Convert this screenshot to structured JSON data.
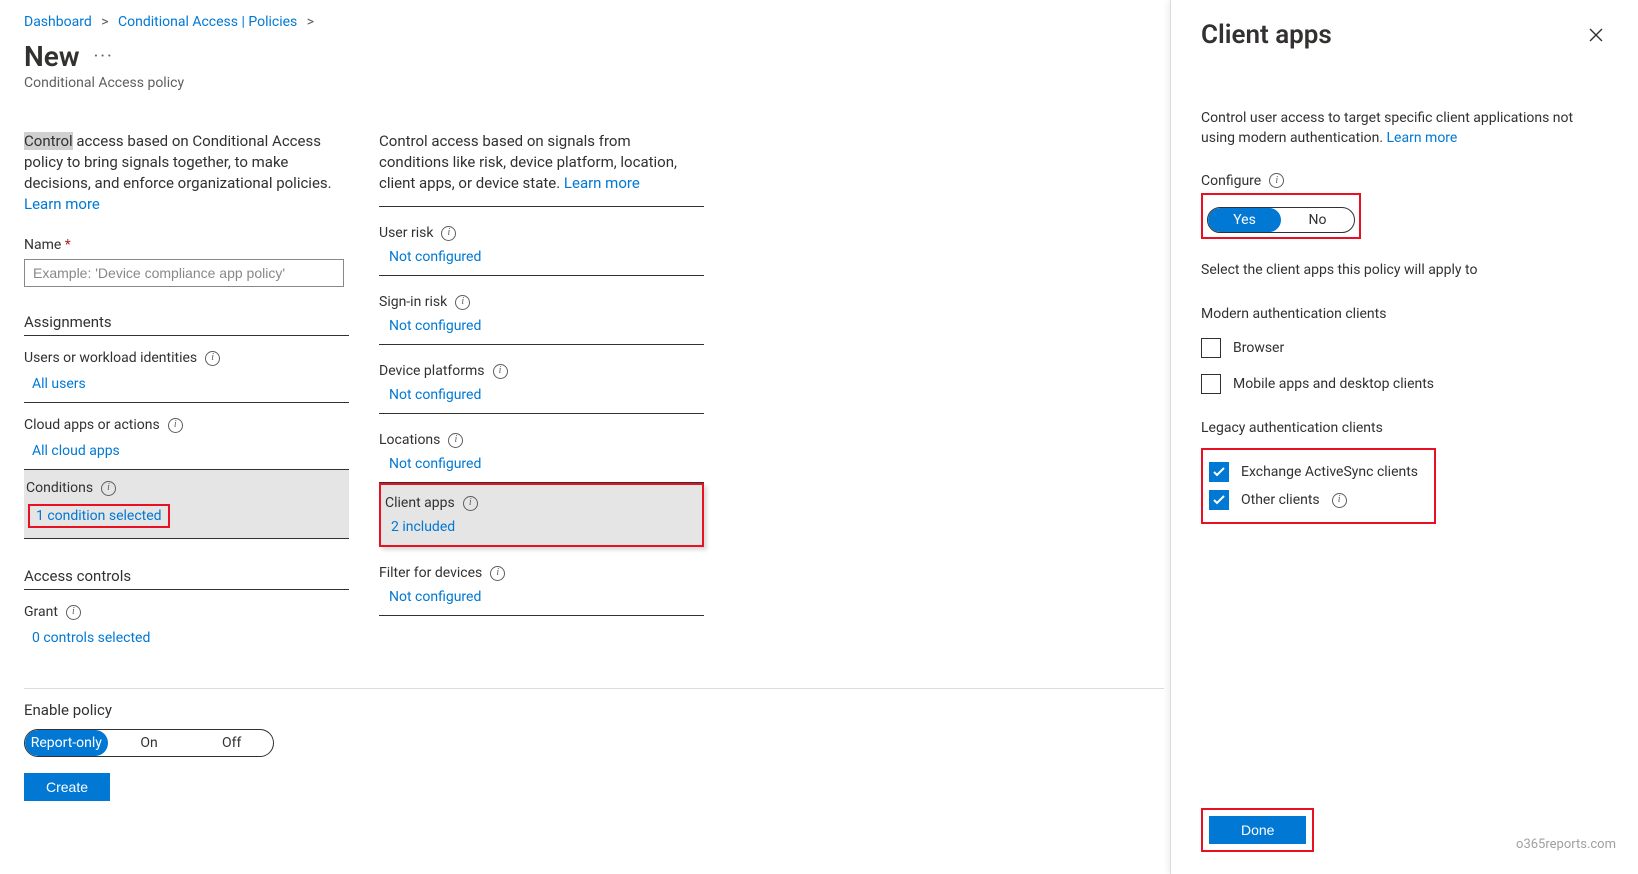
{
  "breadcrumb": {
    "items": [
      "Dashboard",
      "Conditional Access | Policies"
    ]
  },
  "header": {
    "title": "New",
    "subtitle": "Conditional Access policy"
  },
  "left": {
    "intro_hl": "Control",
    "intro_rest": " access based on Conditional Access policy to bring signals together, to make decisions, and enforce organizational policies. ",
    "learn_more": "Learn more",
    "name_label": "Name",
    "name_placeholder": "Example: 'Device compliance app policy'",
    "assignments_header": "Assignments",
    "users_label": "Users or workload identities",
    "users_value": "All users",
    "cloud_label": "Cloud apps or actions",
    "cloud_value": "All cloud apps",
    "conditions_label": "Conditions",
    "conditions_value": "1 condition selected",
    "access_header": "Access controls",
    "grant_label": "Grant",
    "grant_value": "0 controls selected"
  },
  "right": {
    "intro": "Control access based on signals from conditions like risk, device platform, location, client apps, or device state. ",
    "learn_more": "Learn more",
    "items": [
      {
        "label": "User risk",
        "value": "Not configured",
        "info": true
      },
      {
        "label": "Sign-in risk",
        "value": "Not configured",
        "info": true
      },
      {
        "label": "Device platforms",
        "value": "Not configured",
        "info": true
      },
      {
        "label": "Locations",
        "value": "Not configured",
        "info": true
      },
      {
        "label": "Client apps",
        "value": "2 included",
        "info": true,
        "selected": true
      },
      {
        "label": "Filter for devices",
        "value": "Not configured",
        "info": true
      }
    ]
  },
  "footer": {
    "enable_label": "Enable policy",
    "options": [
      "Report-only",
      "On",
      "Off"
    ],
    "active": "Report-only",
    "create": "Create"
  },
  "panel": {
    "title": "Client apps",
    "desc": "Control user access to target specific client applications not using modern authentication. ",
    "learn_more": "Learn more",
    "configure_label": "Configure",
    "yes": "Yes",
    "no": "No",
    "select_text": "Select the client apps this policy will apply to",
    "modern_header": "Modern authentication clients",
    "modern_items": [
      {
        "label": "Browser",
        "checked": false
      },
      {
        "label": "Mobile apps and desktop clients",
        "checked": false
      }
    ],
    "legacy_header": "Legacy authentication clients",
    "legacy_items": [
      {
        "label": "Exchange ActiveSync clients",
        "checked": true,
        "info": false
      },
      {
        "label": "Other clients",
        "checked": true,
        "info": true
      }
    ],
    "done": "Done"
  },
  "watermark": "o365reports.com"
}
